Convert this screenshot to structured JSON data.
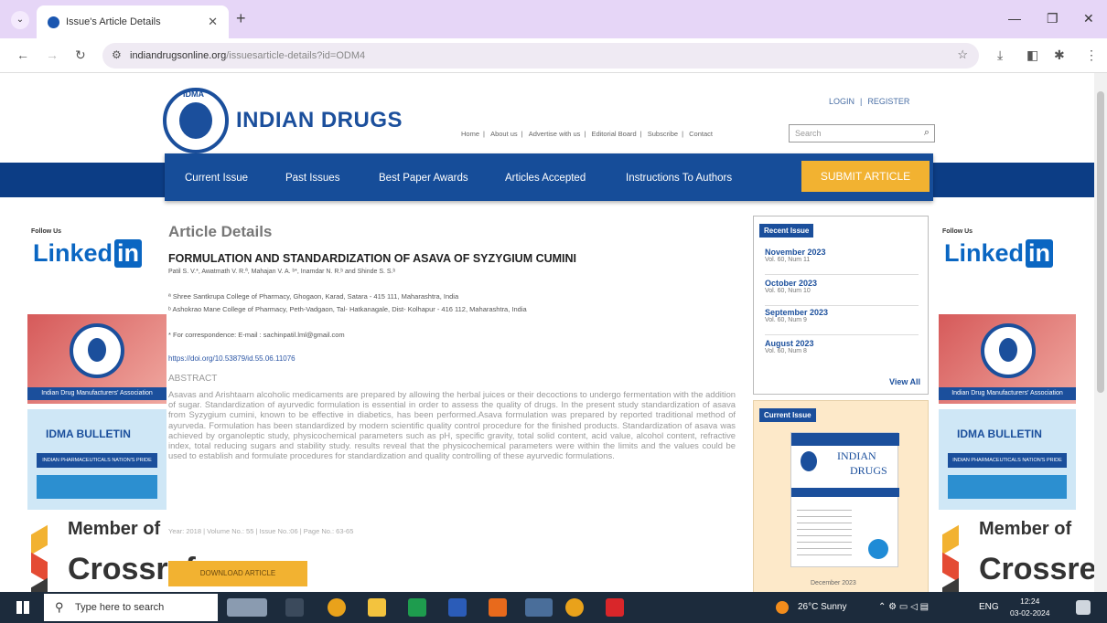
{
  "browser": {
    "tab_title": "Issue's Article Details",
    "url_host": "indiandrugsonline.org",
    "url_path": "/issuesarticle-details?id=ODM4"
  },
  "site": {
    "brand": "INDIAN DRUGS",
    "logo_text": "IDMA",
    "auth": {
      "login": "LOGIN",
      "register": "REGISTER"
    },
    "top_links": [
      "Home",
      "About us",
      "Advertise with us",
      "Editorial Board",
      "Subscribe",
      "Contact"
    ],
    "search_placeholder": "Search",
    "nav": [
      "Current Issue",
      "Past Issues",
      "Best Paper Awards",
      "Articles Accepted",
      "Instructions To Authors"
    ],
    "submit": "SUBMIT ARTICLE"
  },
  "side": {
    "follow": "Follow Us",
    "linkedin": "Linked",
    "linkedin_in": "in",
    "idma_band": "Indian Drug Manufacturers' Association",
    "bulletin_title": "IDMA BULLETIN",
    "bulletin_sub": "INDIAN PHARMACEUTICALS NATION'S PRIDE",
    "crossref_member": "Member of",
    "crossref": "Crossref"
  },
  "article": {
    "section_title": "Article Details",
    "title": "FORMULATION AND STANDARDIZATION OF ASAVA OF SYZYGIUM CUMINI",
    "authors": "Patil S. V.*, Awatmath V. R.ª, Mahajan V. A. ᵇ*, Inamdar N. R.ᵇ and Shinde S. S.ᵇ",
    "aff1": "ª Shree Santkrupa College of Pharmacy, Ghogaon, Karad, Satara - 415 111, Maharashtra, India",
    "aff2": "ᵇ Ashokrao Mane College of Pharmacy, Peth-Vadgaon, Tal- Hatkanagale, Dist- Kolhapur - 416 112, Maharashtra, India",
    "correspondence": "* For correspondence: E-mail : sachinpatil.lml@gmail.com",
    "doi": "https://doi.org/10.53879/id.55.06.11076",
    "abstract_heading": "ABSTRACT",
    "abstract": "Asavas and Arishtaarn alcoholic medicaments are prepared by allowing the herbal juices or their decoctions to undergo fermentation with the addition of sugar. Standardization of ayurvedic formulation is essential in order to assess the quality of drugs. In the present study standardization of asava from Syzygium cumini, known to be effective in diabetics, has been performed.Asava formulation was prepared by reported traditional method of ayurveda. Formulation has been standardized by modern scientific quality control procedure for the finished products. Standardization of asava was achieved by organoleptic study, physicochemical parameters such as pH, specific gravity, total solid content, acid value, alcohol content, refractive index, total reducing sugars and stability study. results reveal that the physicochemical parameters were within the limits and the values could be used to establish and formulate procedures for standardization and quality controlling of these ayurvedic formulations.",
    "meta": "Year: 2018 | Volume No.: 55 | Issue No.:06 | Page No.: 63-65",
    "download": "DOWNLOAD ARTICLE"
  },
  "recent_issue": {
    "heading": "Recent Issue",
    "items": [
      {
        "month": "November  2023",
        "vol": "Vol. 60, Num 11"
      },
      {
        "month": "October  2023",
        "vol": "Vol. 60, Num 10"
      },
      {
        "month": "September  2023",
        "vol": "Vol. 60, Num 9"
      },
      {
        "month": "August  2023",
        "vol": "Vol. 60, Num 8"
      }
    ],
    "view_all": "View All"
  },
  "current_issue": {
    "heading": "Current Issue",
    "cover_title_1": "INDIAN",
    "cover_title_2": "DRUGS",
    "caption": "December 2023"
  },
  "taskbar": {
    "search": "Type here to search",
    "weather": "26°C  Sunny",
    "lang": "ENG",
    "time": "12:24",
    "date": "03-02-2024"
  }
}
